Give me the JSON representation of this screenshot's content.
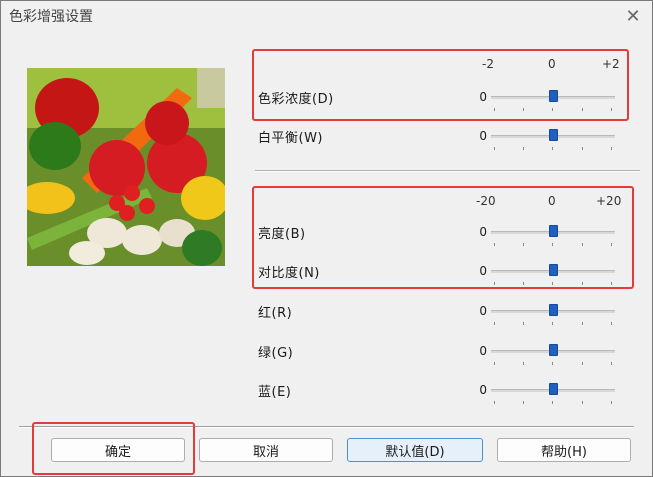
{
  "window": {
    "title": "色彩增强设置",
    "close_icon": "close-icon"
  },
  "preview": {
    "icon": "vegetables-photo"
  },
  "scale_top": {
    "min": "-2",
    "mid": "0",
    "max": "+2"
  },
  "scale_bottom": {
    "min": "-20",
    "mid": "0",
    "max": "+20"
  },
  "controls": {
    "saturation": {
      "label": "色彩浓度(D)",
      "value": "0"
    },
    "white_balance": {
      "label": "白平衡(W)",
      "value": "0"
    },
    "brightness": {
      "label": "亮度(B)",
      "value": "0"
    },
    "contrast": {
      "label": "对比度(N)",
      "value": "0"
    },
    "red": {
      "label": "红(R)",
      "value": "0"
    },
    "green": {
      "label": "绿(G)",
      "value": "0"
    },
    "blue": {
      "label": "蓝(E)",
      "value": "0"
    }
  },
  "buttons": {
    "ok": "确定",
    "cancel": "取消",
    "default": "默认值(D)",
    "help": "帮助(H)"
  },
  "highlight_color": "#e23b3b"
}
